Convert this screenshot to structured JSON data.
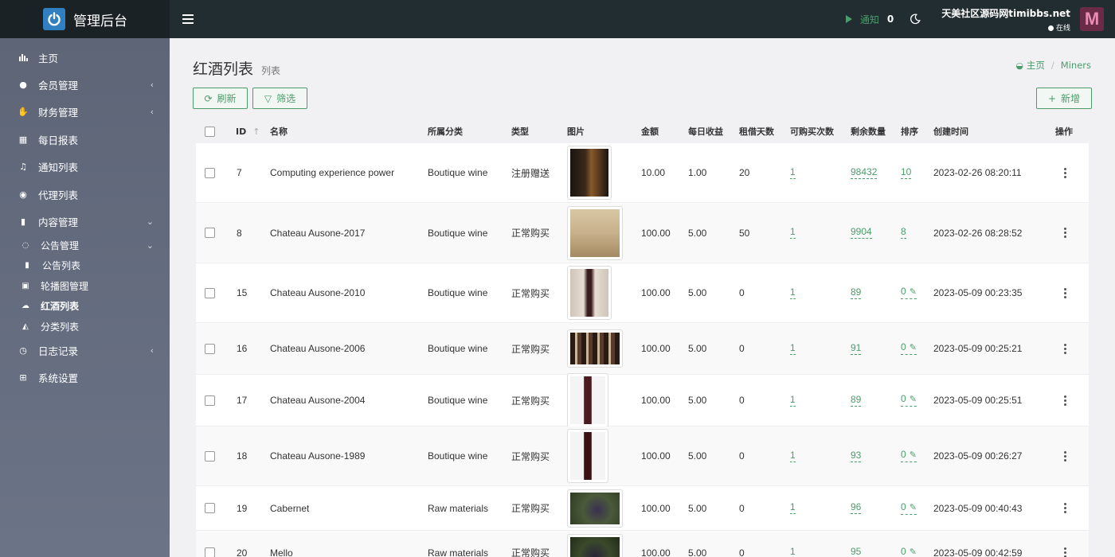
{
  "app": {
    "title": "管理后台"
  },
  "topbar": {
    "notify_label": "通知",
    "notify_count": "0",
    "user_name": "天美社区源码网timibbs.net",
    "user_status": "在线"
  },
  "sidebar": {
    "items": [
      {
        "label": "主页",
        "icon": "bar-chart-icon"
      },
      {
        "label": "会员管理",
        "icon": "user-icon",
        "arrow": "‹"
      },
      {
        "label": "财务管理",
        "icon": "handshake-icon",
        "arrow": "‹"
      },
      {
        "label": "每日报表",
        "icon": "calendar-icon"
      },
      {
        "label": "通知列表",
        "icon": "bell-icon"
      },
      {
        "label": "代理列表",
        "icon": "gauge-icon"
      },
      {
        "label": "内容管理",
        "icon": "bookmark-icon",
        "arrow": "⌄"
      }
    ],
    "sub_notice": {
      "label": "公告管理",
      "icon": "chat-icon",
      "arrow": "⌄"
    },
    "sub_notice_list": {
      "label": "公告列表",
      "icon": "info-icon"
    },
    "sub_items": [
      {
        "label": "轮播图管理",
        "icon": "image-icon"
      },
      {
        "label": "红酒列表",
        "icon": "cloud-icon"
      },
      {
        "label": "分类列表",
        "icon": "category-icon"
      }
    ],
    "bottom_items": [
      {
        "label": "日志记录",
        "icon": "clock-icon",
        "arrow": "‹"
      },
      {
        "label": "系统设置",
        "icon": "windows-icon"
      }
    ]
  },
  "page": {
    "title": "红酒列表",
    "subtitle": "列表",
    "breadcrumb_home": "主页",
    "breadcrumb_current": "Miners"
  },
  "toolbar": {
    "refresh_label": "刷新",
    "filter_label": "筛选",
    "add_label": "新增"
  },
  "table": {
    "headers": {
      "id": "ID",
      "name": "名称",
      "category": "所属分类",
      "type": "类型",
      "image": "图片",
      "amount": "金额",
      "daily": "每日收益",
      "days": "租借天数",
      "buy_times": "可购买次数",
      "remaining": "剩余数量",
      "sort": "排序",
      "created": "创建时间",
      "actions": "操作"
    },
    "rows": [
      {
        "id": "7",
        "name": "Computing experience power",
        "category": "Boutique wine",
        "type": "注册赠送",
        "amount": "10.00",
        "daily": "1.00",
        "days": "20",
        "buy_times": "1",
        "remaining": "98432",
        "sort": "10",
        "created": "2023-02-26 08:20:11"
      },
      {
        "id": "8",
        "name": "Chateau Ausone-2017",
        "category": "Boutique wine",
        "type": "正常购买",
        "amount": "100.00",
        "daily": "5.00",
        "days": "50",
        "buy_times": "1",
        "remaining": "9904",
        "sort": "8",
        "created": "2023-02-26 08:28:52"
      },
      {
        "id": "15",
        "name": "Chateau Ausone-2010",
        "category": "Boutique wine",
        "type": "正常购买",
        "amount": "100.00",
        "daily": "5.00",
        "days": "0",
        "buy_times": "1",
        "remaining": "89",
        "sort": "0",
        "created": "2023-05-09 00:23:35"
      },
      {
        "id": "16",
        "name": "Chateau Ausone-2006",
        "category": "Boutique wine",
        "type": "正常购买",
        "amount": "100.00",
        "daily": "5.00",
        "days": "0",
        "buy_times": "1",
        "remaining": "91",
        "sort": "0",
        "created": "2023-05-09 00:25:21"
      },
      {
        "id": "17",
        "name": "Chateau Ausone-2004",
        "category": "Boutique wine",
        "type": "正常购买",
        "amount": "100.00",
        "daily": "5.00",
        "days": "0",
        "buy_times": "1",
        "remaining": "89",
        "sort": "0",
        "created": "2023-05-09 00:25:51"
      },
      {
        "id": "18",
        "name": "Chateau Ausone-1989",
        "category": "Boutique wine",
        "type": "正常购买",
        "amount": "100.00",
        "daily": "5.00",
        "days": "0",
        "buy_times": "1",
        "remaining": "93",
        "sort": "0",
        "created": "2023-05-09 00:26:27"
      },
      {
        "id": "19",
        "name": "Cabernet",
        "category": "Raw materials",
        "type": "正常购买",
        "amount": "100.00",
        "daily": "5.00",
        "days": "0",
        "buy_times": "1",
        "remaining": "96",
        "sort": "0",
        "created": "2023-05-09 00:40:43"
      },
      {
        "id": "20",
        "name": "Mello",
        "category": "Raw materials",
        "type": "正常购买",
        "amount": "100.00",
        "daily": "5.00",
        "days": "0",
        "buy_times": "1",
        "remaining": "95",
        "sort": "0",
        "created": "2023-05-09 00:42:59"
      }
    ]
  },
  "colors": {
    "accent": "#4a9d6a",
    "topbar": "#222d32",
    "sidebar": "#5d6577"
  }
}
